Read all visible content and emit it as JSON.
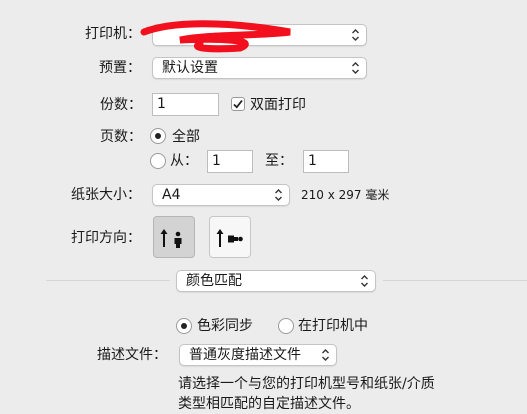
{
  "printer": {
    "label": "打印机：",
    "value": ""
  },
  "presets": {
    "label": "预置：",
    "value": "默认设置"
  },
  "copies": {
    "label": "份数：",
    "value": "1",
    "duplex_label": "双面打印",
    "duplex_checked": true
  },
  "pages": {
    "label": "页数：",
    "all_label": "全部",
    "from_label": "从：",
    "from_value": "1",
    "to_label": "至：",
    "to_value": "1"
  },
  "paper_size": {
    "label": "纸张大小：",
    "value": "A4",
    "dimensions": "210 x 297 毫米"
  },
  "orientation": {
    "label": "打印方向：",
    "selected": "portrait"
  },
  "section": {
    "value": "颜色匹配"
  },
  "color_sync": {
    "colorsync_label": "色彩同步",
    "in_printer_label": "在打印机中"
  },
  "profile": {
    "label": "描述文件：",
    "value": "普通灰度描述文件"
  },
  "description": {
    "line1": "请选择一个与您的打印机型号和纸张/介质",
    "line2": "类型相匹配的自定描述文件。"
  }
}
